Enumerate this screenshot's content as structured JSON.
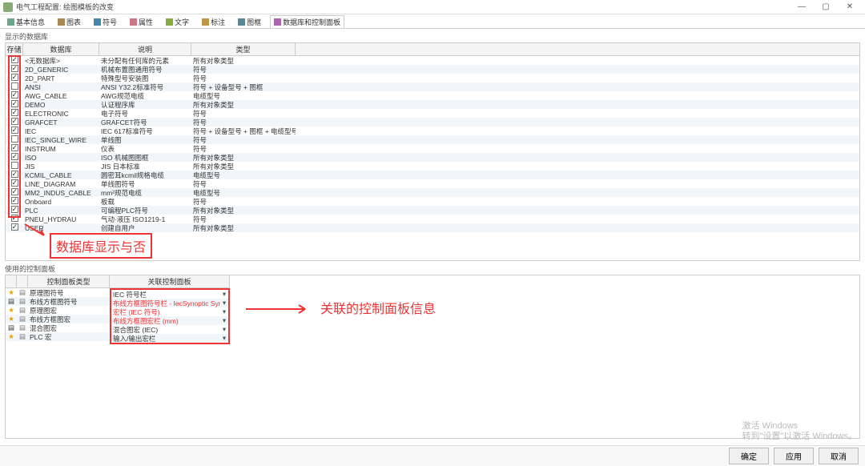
{
  "window": {
    "title": "电气工程配置: 绘图模板的改变",
    "min": "—",
    "max": "▢",
    "close": "✕"
  },
  "tabs": [
    {
      "label": "基本信息"
    },
    {
      "label": "图表"
    },
    {
      "label": "符号"
    },
    {
      "label": "属性"
    },
    {
      "label": "文字"
    },
    {
      "label": "标注"
    },
    {
      "label": "图框"
    },
    {
      "label": "数据库和控制面板"
    }
  ],
  "top": {
    "section": "显示的数据库",
    "headers": {
      "chk": "存储",
      "db": "数据库",
      "desc": "说明",
      "type": "类型"
    },
    "rows": [
      {
        "chk": true,
        "db": "<无数据库>",
        "desc": "未分配有任何库的元素",
        "type": "所有对象类型"
      },
      {
        "chk": true,
        "db": "2D_GENERIC",
        "desc": "机械布置图通用符号",
        "type": "符号"
      },
      {
        "chk": true,
        "db": "2D_PART",
        "desc": "特殊型号安装图",
        "type": "符号"
      },
      {
        "chk": false,
        "db": "ANSI",
        "desc": "ANSI Y32.2标准符号",
        "type": "符号 + 设备型号 + 图框"
      },
      {
        "chk": true,
        "db": "AWG_CABLE",
        "desc": "AWG规范电缆",
        "type": "电缆型号"
      },
      {
        "chk": true,
        "db": "DEMO",
        "desc": "认证程序库",
        "type": "所有对象类型"
      },
      {
        "chk": true,
        "db": "ELECTRONIC",
        "desc": "电子符号",
        "type": "符号"
      },
      {
        "chk": true,
        "db": "GRAFCET",
        "desc": "GRAFCET符号",
        "type": "符号"
      },
      {
        "chk": true,
        "db": "IEC",
        "desc": "IEC 617标准符号",
        "type": "符号 + 设备型号 + 图框 + 电缆型号 + 宏"
      },
      {
        "chk": false,
        "db": "IEC_SINGLE_WIRE",
        "desc": "单线图",
        "type": "符号"
      },
      {
        "chk": true,
        "db": "INSTRUM",
        "desc": "仪表",
        "type": "符号"
      },
      {
        "chk": true,
        "db": "ISO",
        "desc": "ISO 机械图图框",
        "type": "所有对象类型"
      },
      {
        "chk": false,
        "db": "JIS",
        "desc": "JIS 日本标准",
        "type": "所有对象类型"
      },
      {
        "chk": true,
        "db": "KCMIL_CABLE",
        "desc": "圆密耳kcmil规格电缆",
        "type": "电缆型号"
      },
      {
        "chk": true,
        "db": "LINE_DIAGRAM",
        "desc": "单线图符号",
        "type": "符号"
      },
      {
        "chk": true,
        "db": "MM2_INDUS_CABLE",
        "desc": "mm²规范电缆",
        "type": "电缆型号"
      },
      {
        "chk": true,
        "db": "Onboard",
        "desc": "板载",
        "type": "符号"
      },
      {
        "chk": true,
        "db": "PLC",
        "desc": "可编程PLC符号",
        "type": "所有对象类型"
      },
      {
        "chk": true,
        "db": "PNEU_HYDRAU",
        "desc": "气动·液压 ISO1219-1",
        "type": "符号"
      },
      {
        "chk": true,
        "db": "USER",
        "desc": "创建自用户",
        "type": "所有对象类型"
      }
    ]
  },
  "annotations": {
    "a1": "数据库显示与否",
    "a2": "关联的控制面板信息"
  },
  "bottom": {
    "section": "使用的控制面板",
    "left_header": "控制面板类型",
    "right_header": "关联控制面板",
    "left_rows": [
      {
        "icon": "star",
        "label": "原理图符号"
      },
      {
        "icon": "book",
        "label": "布线方框图符号"
      },
      {
        "icon": "star",
        "label": "原理图宏"
      },
      {
        "icon": "star",
        "label": "布线方框图宏"
      },
      {
        "icon": "book",
        "label": "混合图宏"
      },
      {
        "icon": "star",
        "label": "PLC 宏"
      }
    ],
    "right_rows": [
      {
        "label": "IEC 符号栏",
        "red": false
      },
      {
        "label": "布线方框图符号栏 - IecSynoptic SymbolPalette.xml",
        "red": true
      },
      {
        "label": "宏栏 (IEC 符号)",
        "red": true
      },
      {
        "label": "布线方框图宏栏 (mm)",
        "red": true
      },
      {
        "label": "混合图宏 (IEC)",
        "red": false
      },
      {
        "label": "输入/输出宏栏",
        "red": false
      }
    ]
  },
  "footer": {
    "ok": "确定",
    "apply": "应用",
    "cancel": "取消"
  },
  "watermark": {
    "l1": "激活 Windows",
    "l2": "转到\"设置\"以激活 Windows。"
  }
}
